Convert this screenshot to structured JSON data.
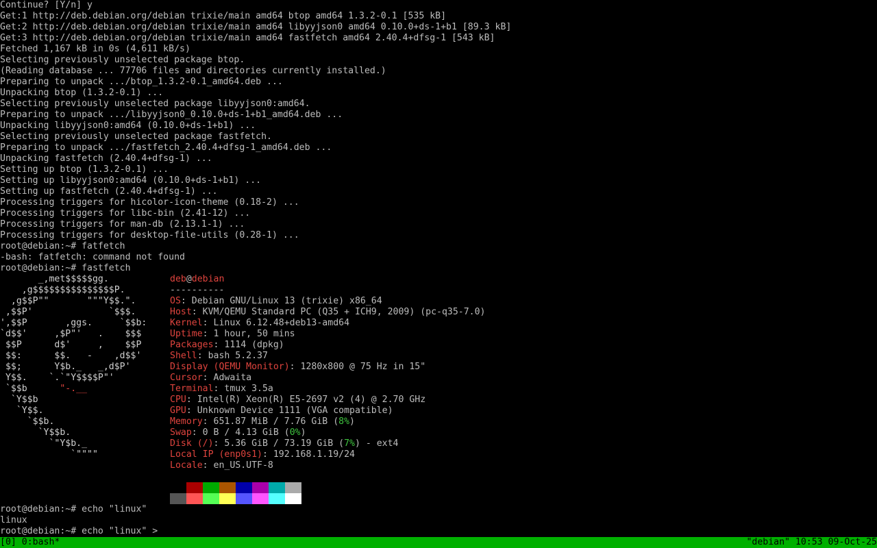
{
  "terminal": {
    "lines": [
      "Continue? [Y/n] y",
      "Get:1 http://deb.debian.org/debian trixie/main amd64 btop amd64 1.3.2-0.1 [535 kB]",
      "Get:2 http://deb.debian.org/debian trixie/main amd64 libyyjson0 amd64 0.10.0+ds-1+b1 [89.3 kB]",
      "Get:3 http://deb.debian.org/debian trixie/main amd64 fastfetch amd64 2.40.4+dfsg-1 [543 kB]",
      "Fetched 1,167 kB in 0s (4,611 kB/s)",
      "Selecting previously unselected package btop.",
      "(Reading database ... 77706 files and directories currently installed.)",
      "Preparing to unpack .../btop_1.3.2-0.1_amd64.deb ...",
      "Unpacking btop (1.3.2-0.1) ...",
      "Selecting previously unselected package libyyjson0:amd64.",
      "Preparing to unpack .../libyyjson0_0.10.0+ds-1+b1_amd64.deb ...",
      "Unpacking libyyjson0:amd64 (0.10.0+ds-1+b1) ...",
      "Selecting previously unselected package fastfetch.",
      "Preparing to unpack .../fastfetch_2.40.4+dfsg-1_amd64.deb ...",
      "Unpacking fastfetch (2.40.4+dfsg-1) ...",
      "Setting up btop (1.3.2-0.1) ...",
      "Setting up libyyjson0:amd64 (0.10.0+ds-1+b1) ...",
      "Setting up fastfetch (2.40.4+dfsg-1) ...",
      "Processing triggers for hicolor-icon-theme (0.18-2) ...",
      "Processing triggers for libc-bin (2.41-12) ...",
      "Processing triggers for man-db (2.13.1-1) ...",
      "Processing triggers for desktop-file-utils (0.28-1) ...",
      "root@debian:~# fatfetch",
      "-bash: fatfetch: command not found",
      "root@debian:~# fastfetch"
    ],
    "after_lines": [
      "root@debian:~# echo \"linux\"",
      "linux",
      "root@debian:~# echo \"linux\" >"
    ]
  },
  "logo": {
    "lines": [
      "       _,met$$$$$gg.",
      "    ,g$$$$$$$$$$$$$$$P.",
      "  ,g$$P\"\"       \"\"\"Y$$.\".",
      " ,$$P'              `$$$.",
      "',$$P       ,ggs.     `$$b:",
      "`d$$'     ,$P\"'   .    $$$",
      " $$P      d$'     ,    $$P",
      " $$:      $$.   -    ,d$$'",
      " $$;      Y$b._   _,d$P'",
      " Y$$.    `.`\"Y$$$$P\"'",
      " `$$b      \"-.__",
      "  `Y$$b",
      "   `Y$$.",
      "     `$$b.",
      "       `Y$$b.",
      "         `\"Y$b._",
      "             `\"\"\"\""
    ],
    "red_fragment": "\"-.__"
  },
  "fastfetch": {
    "user": "deb",
    "at": "@",
    "host": "debian",
    "separator": "----------",
    "entries": [
      {
        "key": "OS",
        "value": ": Debian GNU/Linux 13 (trixie) x86_64"
      },
      {
        "key": "Host",
        "value": ": KVM/QEMU Standard PC (Q35 + ICH9, 2009) (pc-q35-7.0)"
      },
      {
        "key": "Kernel",
        "value": ": Linux 6.12.48+deb13-amd64"
      },
      {
        "key": "Uptime",
        "value": ": 1 hour, 50 mins"
      },
      {
        "key": "Packages",
        "value": ": 1114 (dpkg)"
      },
      {
        "key": "Shell",
        "value": ": bash 5.2.37"
      },
      {
        "key": "Display (QEMU Monitor)",
        "value": ": 1280x800 @ 75 Hz in 15\""
      },
      {
        "key": "Cursor",
        "value": ": Adwaita"
      },
      {
        "key": "Terminal",
        "value": ": tmux 3.5a"
      },
      {
        "key": "CPU",
        "value": ": Intel(R) Xeon(R) E5-2697 v2 (4) @ 2.70 GHz"
      },
      {
        "key": "GPU",
        "value": ": Unknown Device 1111 (VGA compatible)"
      },
      {
        "key": "Memory",
        "value": ": 651.87 MiB / 7.76 GiB (",
        "pct": "8%",
        "tail": ")"
      },
      {
        "key": "Swap",
        "value": ": 0 B / 4.13 GiB (",
        "pct": "0%",
        "tail": ")"
      },
      {
        "key": "Disk (/)",
        "value": ": 5.36 GiB / 73.19 GiB (",
        "pct": "7%",
        "tail": ") - ext4"
      },
      {
        "key": "Local IP (enp0s1)",
        "value": ": 192.168.1.19/24"
      },
      {
        "key": "Locale",
        "value": ": en_US.UTF-8"
      }
    ]
  },
  "palette": {
    "top": [
      "#000000",
      "#aa0000",
      "#00aa00",
      "#aa5500",
      "#0000aa",
      "#aa00aa",
      "#00aaaa",
      "#aaaaaa"
    ],
    "bottom": [
      "#555555",
      "#ff5555",
      "#55ff55",
      "#ffff55",
      "#5555ff",
      "#ff55ff",
      "#55ffff",
      "#ffffff"
    ]
  },
  "statusbar": {
    "left": "[0] 0:bash*",
    "right": "\"debian\" 10:53 09-Oct-25",
    "bg": "#00b000"
  },
  "colors": {
    "text": "#bdbdbd",
    "accent_red": "#e0443e",
    "accent_green": "#3fc43f"
  }
}
